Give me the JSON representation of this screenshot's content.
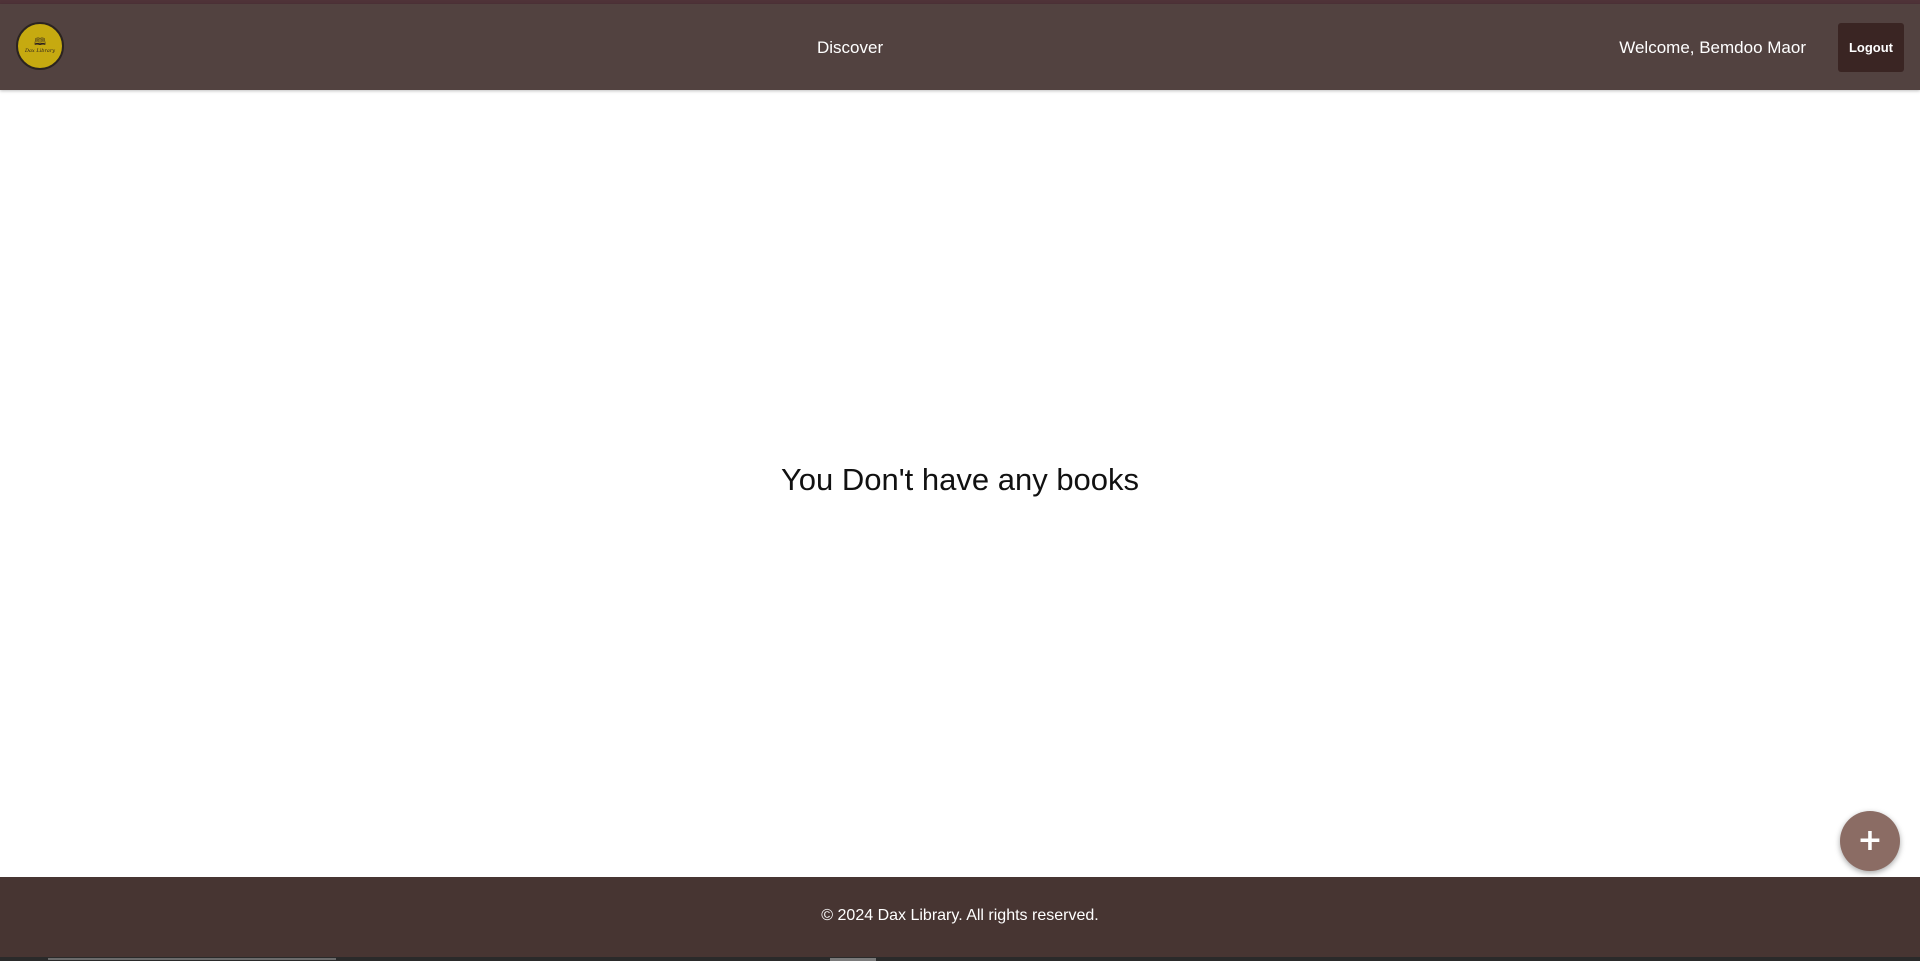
{
  "brand": {
    "logo_icon": "open-book-icon",
    "logo_text": "Dax Library",
    "logo_color": "#c6aa10"
  },
  "navbar": {
    "background": "#524240",
    "discover_label": "Discover",
    "welcome_text": "Welcome, Bemdoo Maor",
    "logout_label": "Logout"
  },
  "main": {
    "empty_message": "You Don't have any books"
  },
  "fab": {
    "icon": "plus-icon",
    "label": "+",
    "color": "#8b6c64"
  },
  "footer": {
    "text": "© 2024 Dax Library. All rights reserved.",
    "background": "#473532"
  }
}
